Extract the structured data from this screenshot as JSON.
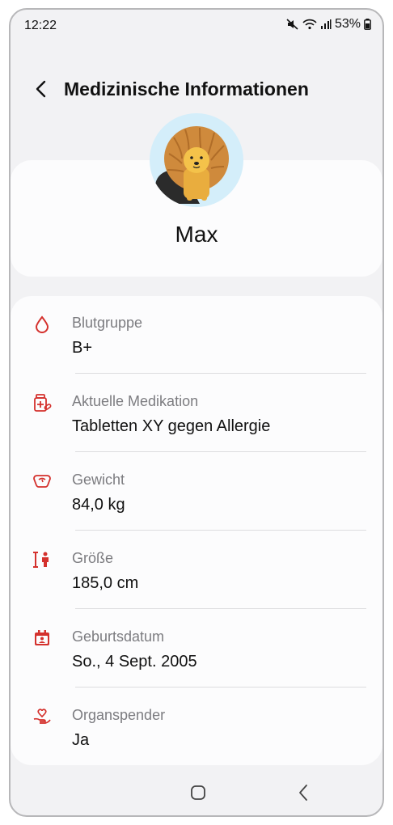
{
  "status_bar": {
    "time": "12:22",
    "battery": "53%",
    "icons": [
      "mute-icon",
      "wifi-icon",
      "signal-icon",
      "battery-icon"
    ]
  },
  "header": {
    "title": "Medizinische Informationen",
    "back_icon": "chevron-left-icon"
  },
  "profile": {
    "name": "Max",
    "avatar": "lion-avatar"
  },
  "info": [
    {
      "icon": "blood-drop-icon",
      "label": "Blutgruppe",
      "value": "B+"
    },
    {
      "icon": "medication-icon",
      "label": "Aktuelle Medikation",
      "value": "Tabletten XY gegen Allergie"
    },
    {
      "icon": "scale-icon",
      "label": "Gewicht",
      "value": "84,0 kg"
    },
    {
      "icon": "height-icon",
      "label": "Größe",
      "value": "185,0 cm"
    },
    {
      "icon": "calendar-icon",
      "label": "Geburtsdatum",
      "value": "So., 4 Sept. 2005"
    },
    {
      "icon": "organ-donor-icon",
      "label": "Organspender",
      "value": "Ja"
    }
  ],
  "nav_bar": {
    "icons": [
      "home-icon",
      "back-icon"
    ]
  },
  "colors": {
    "accent": "#d4312d",
    "background": "#f2f2f4",
    "card": "#fcfcfd",
    "avatar_bg": "#d4eefa"
  }
}
